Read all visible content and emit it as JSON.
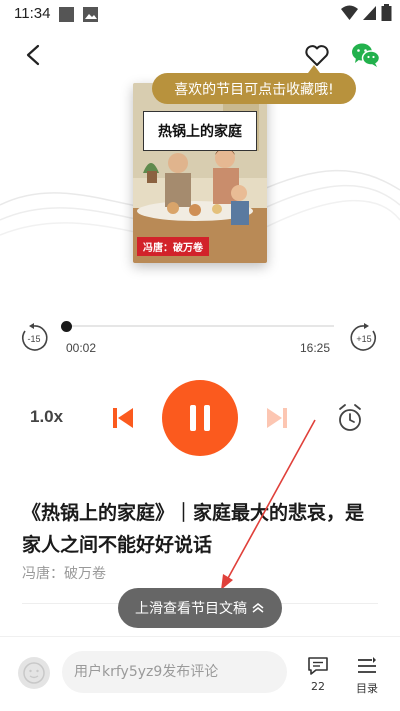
{
  "status_bar": {
    "time": "11:34"
  },
  "tooltip": {
    "text": "喜欢的节目可点击收藏哦!"
  },
  "cover": {
    "title": "热锅上的家庭",
    "author_tag": "冯唐：破万卷"
  },
  "player": {
    "current_time": "00:02",
    "total_time": "16:25",
    "progress": 0.002,
    "speed": "1.0x",
    "rewind_label": "-15",
    "forward_label": "+15"
  },
  "episode": {
    "title": "《热锅上的家庭》｜家庭最大的悲哀，是家人之间不能好好说话",
    "author": "冯唐：破万卷"
  },
  "swipe_hint": {
    "text": "上滑查看节目文稿"
  },
  "bottom_bar": {
    "comment_placeholder": "用户krfy5yz9发布评论",
    "comment_count": "22",
    "catalog_label": "目录"
  },
  "colors": {
    "accent": "#fb5a1e",
    "tooltip": "#b8923d",
    "wechat": "#22b14c"
  }
}
